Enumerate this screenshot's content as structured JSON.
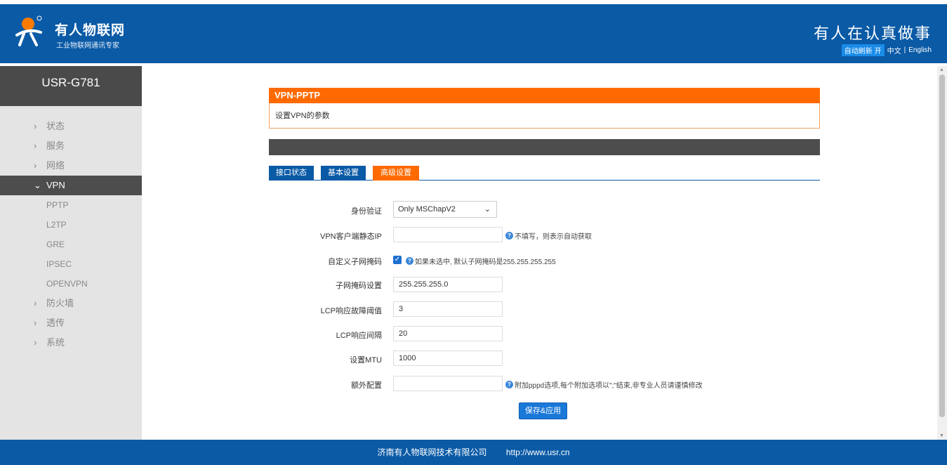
{
  "header": {
    "brand_name": "有人物联网",
    "brand_sub": "工业物联网通讯专家",
    "slogan": "有人在认真做事",
    "auto_refresh": "自动刷新 开",
    "lang_zh": "中文",
    "lang_sep": "|",
    "lang_en": "English"
  },
  "sidebar": {
    "device": "USR-G781",
    "items": [
      {
        "label": "状态"
      },
      {
        "label": "服务"
      },
      {
        "label": "网络"
      },
      {
        "label": "VPN"
      },
      {
        "label": "防火墙"
      },
      {
        "label": "透传"
      },
      {
        "label": "系统"
      }
    ],
    "vpn_sub": [
      "PPTP",
      "L2TP",
      "GRE",
      "IPSEC",
      "OPENVPN"
    ]
  },
  "panel": {
    "title": "VPN-PPTP",
    "description": "设置VPN的参数"
  },
  "tabs": [
    "接口状态",
    "基本设置",
    "高级设置"
  ],
  "form": {
    "auth_label": "身份验证",
    "auth_value": "Only MSChapV2",
    "static_ip_label": "VPN客户端静态IP",
    "static_ip_value": "",
    "static_ip_hint": "不填写，则表示自动获取",
    "custom_mask_label": "自定义子网掩码",
    "custom_mask_hint": "如果未选中, 默认子网掩码是255.255.255.255",
    "mask_label": "子网掩码设置",
    "mask_value": "255.255.255.0",
    "lcp_threshold_label": "LCP响应故障阈值",
    "lcp_threshold_value": "3",
    "lcp_interval_label": "LCP响应间隔",
    "lcp_interval_value": "20",
    "mtu_label": "设置MTU",
    "mtu_value": "1000",
    "extra_label": "额外配置",
    "extra_value": "",
    "extra_hint": "附加pppd选项,每个附加选项以\";\"结束,非专业人员请谨慎修改",
    "save_label": "保存&应用"
  },
  "footer": {
    "company": "济南有人物联网技术有限公司",
    "url": "http://www.usr.cn"
  },
  "colors": {
    "primary": "#0a5aa6",
    "accent": "#ff6a00",
    "sidebar_dark": "#4d4d4d"
  }
}
